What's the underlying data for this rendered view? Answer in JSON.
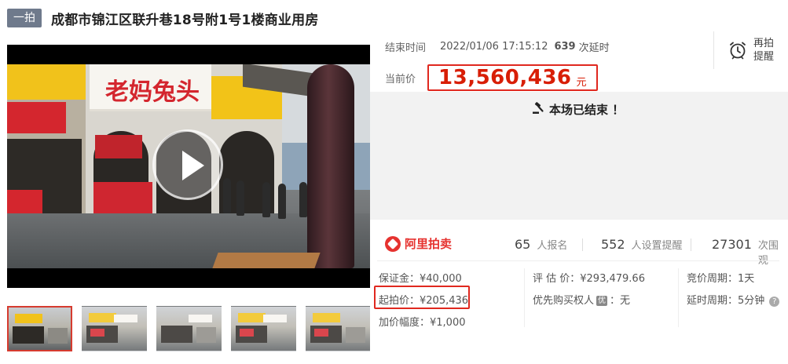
{
  "header": {
    "badge": "一拍",
    "title": "成都市锦江区联升巷18号附1号1楼商业用房"
  },
  "video": {
    "shop_sign": "老妈兔头"
  },
  "thumbnails_count": 5,
  "auction": {
    "end_label": "结束时间",
    "end_time": "2022/01/06 17:15:12",
    "delay_count": "639",
    "delay_unit": "次延时",
    "remind_label": "再拍提醒",
    "price_label": "当前价",
    "price": "13,560,436",
    "price_unit": "元",
    "ended_text": "本场已结束 ！"
  },
  "platform": {
    "logo_text": "阿里拍卖"
  },
  "stats": [
    {
      "num": "65",
      "unit": "人报名"
    },
    {
      "num": "552",
      "unit": "人设置提醒"
    },
    {
      "num": "27301",
      "unit": "次围观"
    }
  ],
  "details": {
    "deposit": "保证金：¥40,000",
    "start_price": "起拍价：¥205,436",
    "increment": "加价幅度：¥1,000",
    "appraisal": "评 估 价：¥293,479.66",
    "priority_prefix": "优先购买权人",
    "priority_tag": "优",
    "priority_suffix": "：无",
    "bid_cycle": "竞价周期：1天",
    "delay_cycle": "延时周期：5分钟"
  },
  "colors": {
    "accent_red": "#e0281f",
    "price_red": "#d81e06",
    "badge_gray": "#6f7a8c"
  }
}
